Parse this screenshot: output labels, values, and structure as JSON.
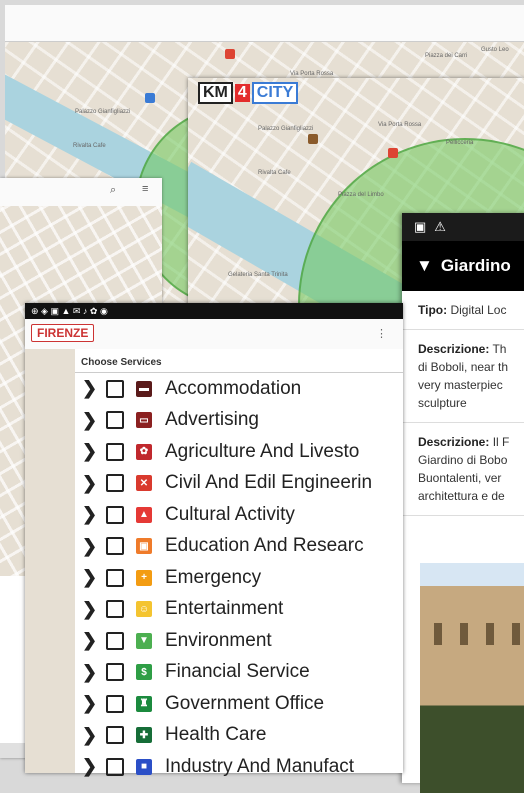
{
  "back_window": {
    "map_labels": [
      "Piazza dei Carri",
      "Via Porta Rossa",
      "Palazzo Gianfigliazzi",
      "Rivalta Cafe",
      "Gusto Leo"
    ]
  },
  "mid_window": {
    "logo": {
      "k": "KM",
      "n": "4",
      "c": "CITY"
    },
    "map_labels": [
      "Palazzo Gianfigliazzi",
      "Rivalta Cafe",
      "Piazza del Limbo",
      "Via Porta Rossa",
      "Pellicceria",
      "Gelateria Santa Trinita"
    ]
  },
  "detail": {
    "title": "Giardino",
    "rows": [
      {
        "label": "Tipo:",
        "lines": [
          " Digital Loc"
        ]
      },
      {
        "label": "Descrizione:",
        "lines": [
          " Th",
          "di Boboli, near th",
          "very masterpiec",
          "sculpture"
        ]
      },
      {
        "label": "Descrizione:",
        "lines": [
          " Il F",
          "Giardino di Bobo",
          "Buontalenti, ver",
          "architettura e de"
        ]
      }
    ]
  },
  "services": {
    "city": "FIRENZE",
    "heading": "Choose Services",
    "items": [
      {
        "label": "Accommodation",
        "color": "#5a1a1a",
        "glyph": "▬"
      },
      {
        "label": "Advertising",
        "color": "#8b2020",
        "glyph": "▭"
      },
      {
        "label": "Agriculture And Livesto",
        "color": "#c0282d",
        "glyph": "✿"
      },
      {
        "label": "Civil And Edil Engineerin",
        "color": "#d93a2e",
        "glyph": "✕"
      },
      {
        "label": "Cultural Activity",
        "color": "#e53935",
        "glyph": "▲"
      },
      {
        "label": "Education And Researc",
        "color": "#ef7b2a",
        "glyph": "▣"
      },
      {
        "label": "Emergency",
        "color": "#f39c12",
        "glyph": "+"
      },
      {
        "label": "Entertainment",
        "color": "#f4c430",
        "glyph": "☺"
      },
      {
        "label": "Environment",
        "color": "#4caf50",
        "glyph": "▼"
      },
      {
        "label": "Financial Service",
        "color": "#2e9e45",
        "glyph": "$"
      },
      {
        "label": "Government Office",
        "color": "#1b8a3e",
        "glyph": "♜"
      },
      {
        "label": "Health Care",
        "color": "#166d38",
        "glyph": "✚"
      },
      {
        "label": "Industry And Manufact",
        "color": "#2b4fc7",
        "glyph": "■"
      }
    ]
  }
}
